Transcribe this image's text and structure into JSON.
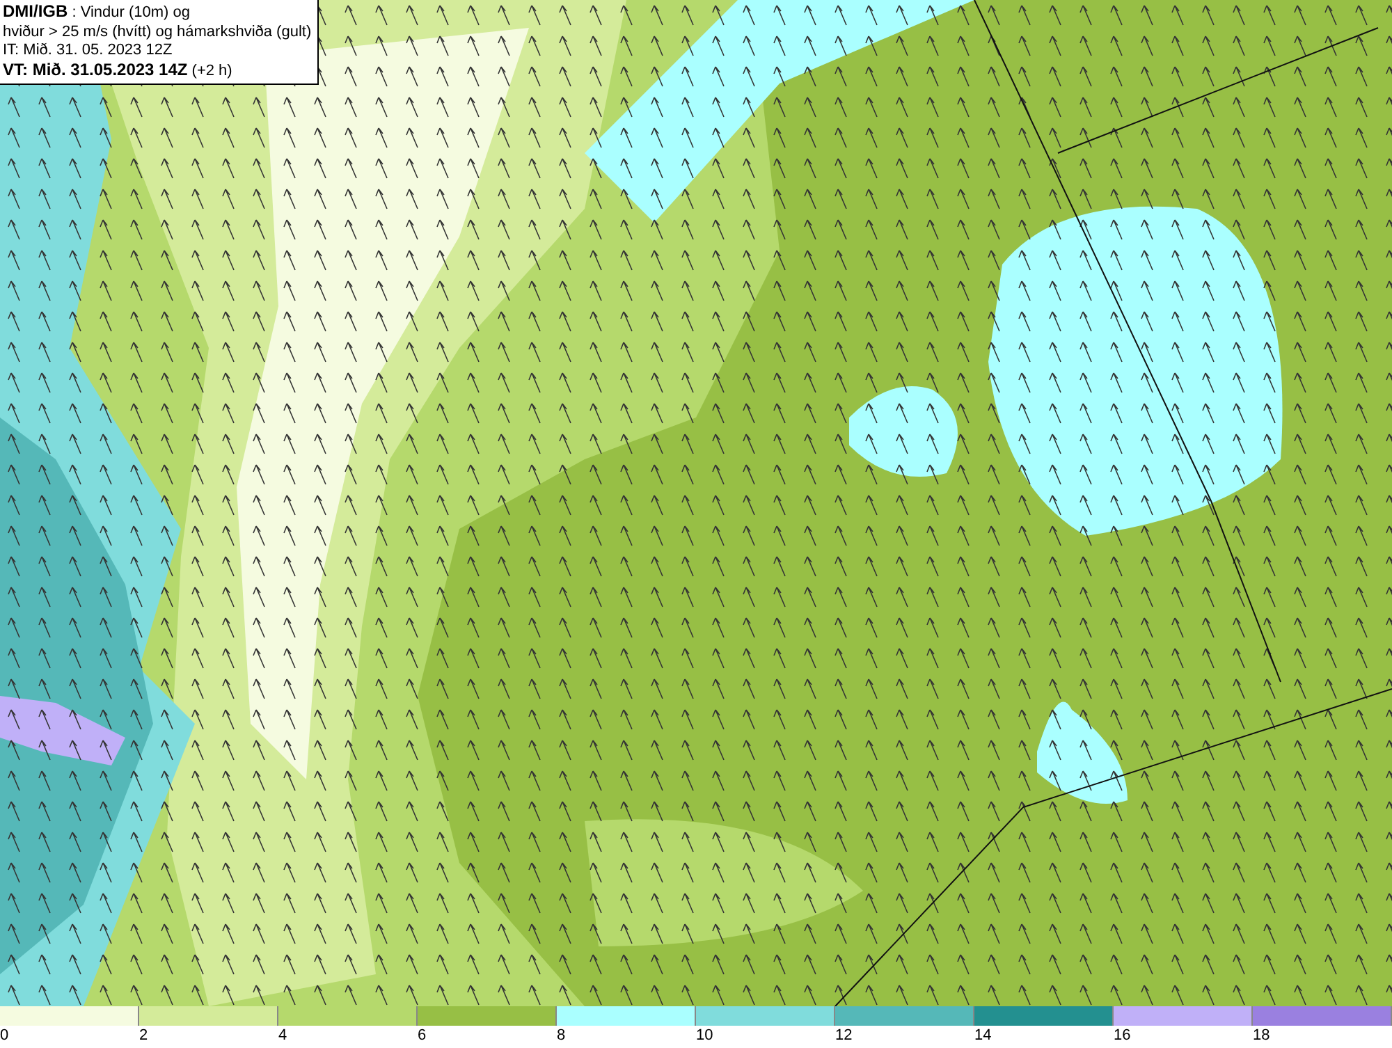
{
  "title_box": {
    "lines": [
      "**DMI/IGB** : Vindur (10m) og",
      "hviður > 25 m/s (hvítt) og hámarkshviða (gult)",
      "IT: Mið. 31. 05. 2023 12Z",
      "**VT: Mið. 31.05.2023 14Z** (+2 h)"
    ]
  },
  "legend": [
    {
      "label": "0",
      "color": "#f5fbe0"
    },
    {
      "label": "2",
      "color": "#d4eb9a"
    },
    {
      "label": "4",
      "color": "#b5d96c"
    },
    {
      "label": "6",
      "color": "#97bf45"
    },
    {
      "label": "8",
      "color": "#aaffff"
    },
    {
      "label": "10",
      "color": "#80dcdc"
    },
    {
      "label": "12",
      "color": "#55b8b8"
    },
    {
      "label": "14",
      "color": "#239090"
    },
    {
      "label": "16",
      "color": "#c0b0f8"
    },
    {
      "label": "18",
      "color": "#9a80e0"
    }
  ]
}
